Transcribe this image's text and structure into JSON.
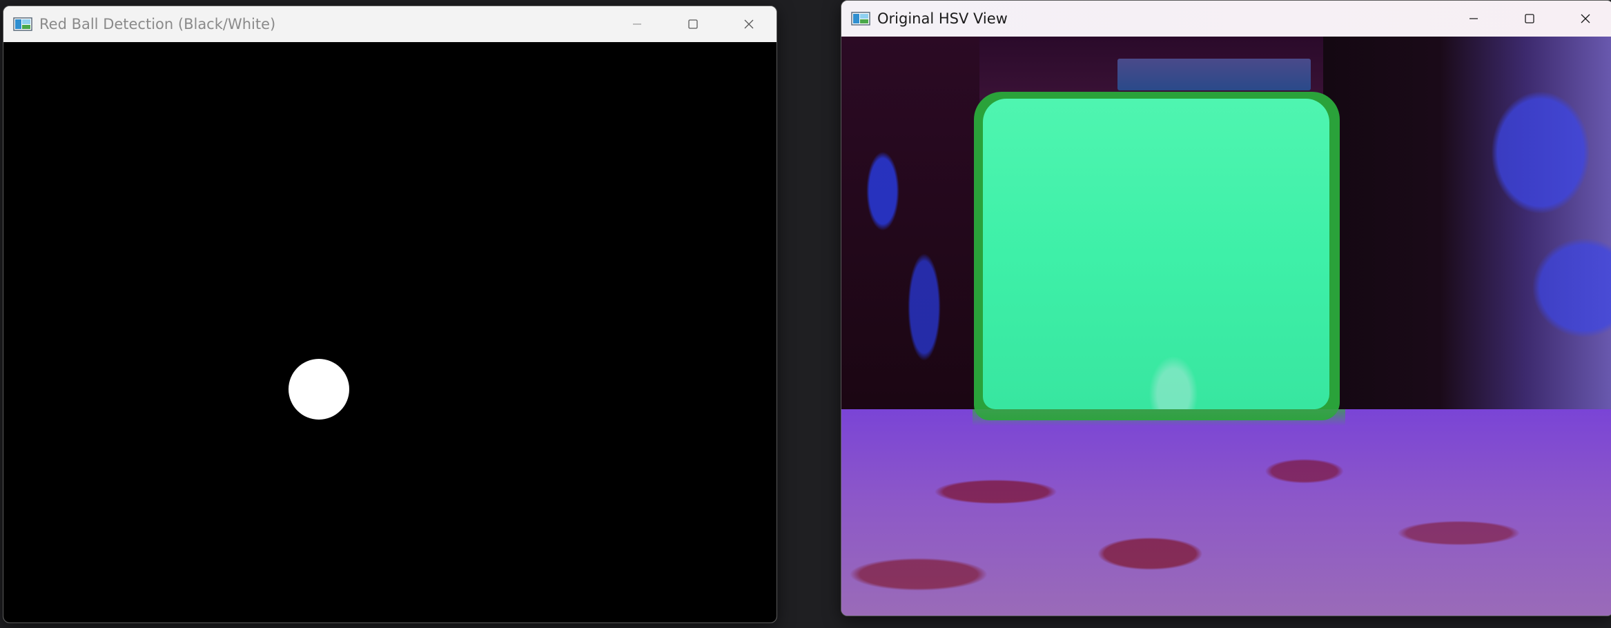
{
  "windows": [
    {
      "title": "Red Ball Detection (Black/White)",
      "icon": "app-image-icon",
      "view": "binary-mask"
    },
    {
      "title": "Original HSV View",
      "icon": "app-image-icon",
      "view": "hsv-image"
    }
  ],
  "caption_buttons": {
    "minimize": "minimize-icon",
    "maximize": "maximize-icon",
    "close": "close-icon"
  },
  "colors": {
    "desktop": "#1f1f22",
    "titlebar": "#f3f3f3",
    "mask_background": "#000000",
    "mask_foreground": "#ffffff",
    "hsv_pillow": "#3ef0a8",
    "hsv_floor": "#8d58c8"
  }
}
